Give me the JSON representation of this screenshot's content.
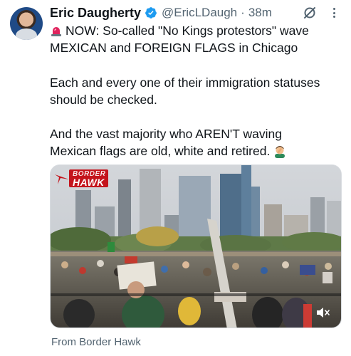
{
  "author": {
    "name": "Eric Daugherty",
    "handle": "@EricLDaugh",
    "separator": "·",
    "time": "38m"
  },
  "post": {
    "line1": "NOW: So-called \"No Kings protestors\" wave",
    "line2": "MEXICAN and FOREIGN FLAGS in Chicago",
    "para2_line1": "Each and every one of their immigration statuses",
    "para2_line2": "should be checked.",
    "para3_line1": "And the vast majority who AREN'T waving",
    "para3_line2": "Mexican flags are old, white and retired."
  },
  "media": {
    "logo_line1": "BORDER",
    "logo_line2": "HAWK"
  },
  "source_label": "From Border Hawk",
  "icons": {
    "verified": "verified-badge-icon",
    "grok": "grok-icon",
    "more": "more-options-icon",
    "siren": "police-siren-icon",
    "facepalm": "man-facepalming-icon",
    "mute": "muted-speaker-icon"
  },
  "colors": {
    "verified_blue": "#1d9bf0",
    "secondary_text": "#536471",
    "brand_red": "#c4141c"
  }
}
